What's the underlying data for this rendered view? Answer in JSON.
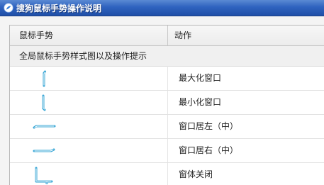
{
  "window": {
    "title": "搜狗鼠标手势操作说明"
  },
  "table": {
    "headers": {
      "gesture": "鼠标手势",
      "action": "动作"
    },
    "section_title": "全局鼠标手势样式图以及操作提示",
    "rows": [
      {
        "gesture_icon": "stroke-up-icon",
        "action": "最大化窗口"
      },
      {
        "gesture_icon": "stroke-down-icon",
        "action": "最小化窗口"
      },
      {
        "gesture_icon": "stroke-left-icon",
        "action": "窗口居左（中）"
      },
      {
        "gesture_icon": "stroke-right-icon",
        "action": "窗口居右（中）"
      },
      {
        "gesture_icon": "stroke-down-right-icon",
        "action": "窗体关闭"
      }
    ]
  },
  "colors": {
    "titlebar": "#2f63bf",
    "gesture_stroke": "#3aa7d6"
  }
}
